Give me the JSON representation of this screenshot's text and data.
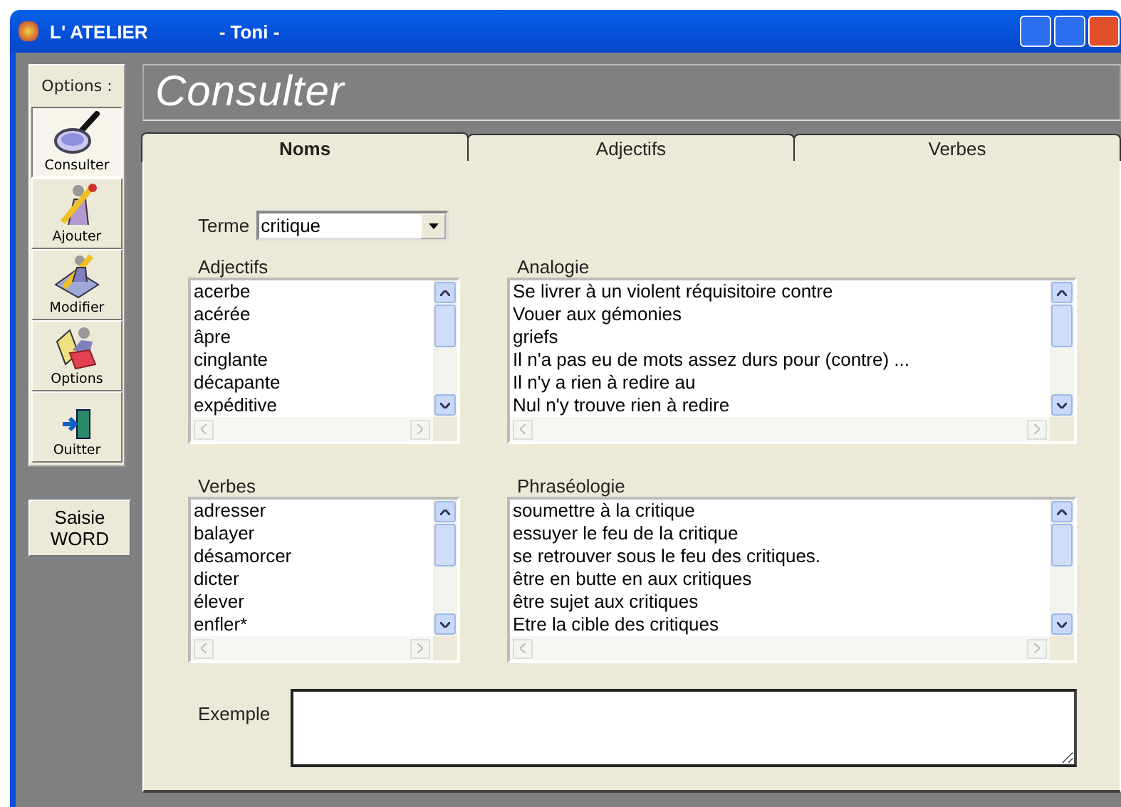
{
  "window": {
    "title": "L' ATELIER",
    "subtitle": "- Toni -"
  },
  "sidebar": {
    "header": "Options :",
    "items": [
      {
        "label": "Consulter",
        "kind": "magnifier",
        "selected": true
      },
      {
        "label": "Ajouter",
        "kind": "pencil",
        "selected": false
      },
      {
        "label": "Modifier",
        "kind": "edit",
        "selected": false
      },
      {
        "label": "Options",
        "kind": "options",
        "selected": false
      },
      {
        "label": "Ouitter",
        "kind": "exit",
        "selected": false
      }
    ],
    "extra_button": "Saisie WORD"
  },
  "header": {
    "title": "Consulter"
  },
  "tabs": [
    {
      "label": "Noms",
      "selected": true
    },
    {
      "label": "Adjectifs",
      "selected": false
    },
    {
      "label": "Verbes",
      "selected": false
    }
  ],
  "term": {
    "label": "Terme",
    "value": "critique"
  },
  "lists": [
    {
      "label": "Adjectifs",
      "items": [
        "acerbe",
        "acérée",
        "âpre",
        "cinglante",
        "décapante",
        "expéditive"
      ]
    },
    {
      "label": "Analogie",
      "items": [
        "Se livrer à un violent réquisitoire contre",
        "Vouer aux gémonies",
        "griefs",
        "Il n'a pas eu de mots assez durs pour (contre) ...",
        "Il n'y a rien à redire au",
        "Nul n'y trouve rien à redire"
      ]
    },
    {
      "label": "Verbes",
      "items": [
        "adresser",
        "balayer",
        "désamorcer",
        "dicter",
        "élever",
        "enfler*"
      ]
    },
    {
      "label": "Phraséologie",
      "items": [
        "soumettre à la critique",
        "essuyer le feu de la critique",
        "se retrouver sous le feu des critiques.",
        "être en butte en aux critiques",
        "être sujet aux critiques",
        "Etre la cible des critiques"
      ]
    }
  ],
  "example": {
    "label": "Exemple"
  }
}
